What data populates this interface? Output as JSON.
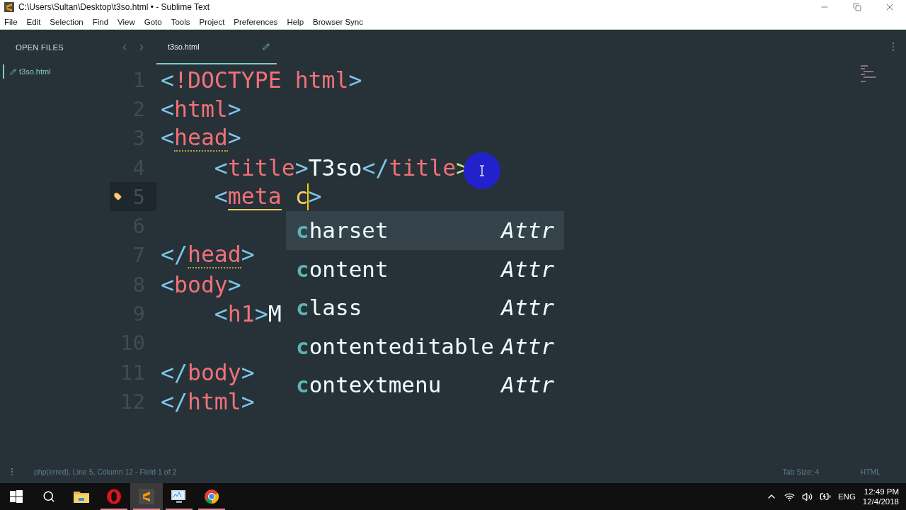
{
  "window": {
    "title": "C:\\Users\\Sultan\\Desktop\\t3so.html • - Sublime Text"
  },
  "menu": [
    "File",
    "Edit",
    "Selection",
    "Find",
    "View",
    "Goto",
    "Tools",
    "Project",
    "Preferences",
    "Help",
    "Browser Sync"
  ],
  "sidebar": {
    "heading": "OPEN FILES",
    "files": [
      {
        "name": "t3so.html",
        "selected": true
      }
    ]
  },
  "tabs": [
    {
      "label": "t3so.html",
      "selected": true
    }
  ],
  "code": {
    "lines": [
      {
        "number": "1",
        "current": false,
        "tokens": [
          {
            "kind": "punct",
            "text": "<"
          },
          {
            "kind": "tag",
            "text": "!DOCTYPE html"
          },
          {
            "kind": "punct",
            "text": ">"
          }
        ]
      },
      {
        "number": "2",
        "current": false,
        "tokens": [
          {
            "kind": "punct",
            "text": "<"
          },
          {
            "kind": "tag",
            "text": "html"
          },
          {
            "kind": "punct",
            "text": ">"
          }
        ]
      },
      {
        "number": "3",
        "current": false,
        "tokens": [
          {
            "kind": "punct",
            "text": "<"
          },
          {
            "kind": "tag",
            "text": "head",
            "underlined": true,
            "dotted": true
          },
          {
            "kind": "punct",
            "text": ">"
          }
        ]
      },
      {
        "number": "4",
        "current": false,
        "tokens": [
          {
            "kind": "punct",
            "text": "    <"
          },
          {
            "kind": "tag",
            "text": "title"
          },
          {
            "kind": "punct",
            "text": ">"
          },
          {
            "kind": "text",
            "text": "T3so"
          },
          {
            "kind": "punct",
            "text": "</"
          },
          {
            "kind": "tag",
            "text": "title"
          },
          {
            "kind": "match",
            "text": ">"
          }
        ]
      },
      {
        "number": "5",
        "current": true,
        "tokens": [
          {
            "kind": "punct",
            "text": "    <"
          },
          {
            "kind": "tag",
            "text": "meta",
            "underlined": true,
            "dotted": false
          },
          {
            "kind": "attr",
            "text": "c",
            "caret": true
          },
          {
            "kind": "punct",
            "text": ">"
          }
        ]
      },
      {
        "number": "6",
        "current": false
      },
      {
        "number": "7",
        "current": false,
        "tokens": [
          {
            "kind": "punct",
            "text": "</"
          },
          {
            "kind": "tag",
            "text": "head",
            "underlined": true,
            "dotted": true
          },
          {
            "kind": "punct",
            "text": ">"
          }
        ]
      },
      {
        "number": "8",
        "current": false,
        "tokens": [
          {
            "kind": "punct",
            "text": "<"
          },
          {
            "kind": "tag",
            "text": "body"
          },
          {
            "kind": "punct",
            "text": ">"
          }
        ]
      },
      {
        "number": "9",
        "current": false,
        "tokens": [
          {
            "kind": "punct",
            "text": "    <"
          },
          {
            "kind": "tag",
            "text": "h1"
          },
          {
            "kind": "punct",
            "text": ">"
          },
          {
            "kind": "text",
            "text": "M"
          }
        ]
      },
      {
        "number": "10",
        "current": false
      },
      {
        "number": "11",
        "current": false,
        "tokens": [
          {
            "kind": "punct",
            "text": "</"
          },
          {
            "kind": "tag",
            "text": "body"
          },
          {
            "kind": "punct",
            "text": ">"
          }
        ]
      },
      {
        "number": "12",
        "current": false,
        "tokens": [
          {
            "kind": "punct",
            "text": "</"
          },
          {
            "kind": "tag",
            "text": "html"
          },
          {
            "kind": "punct",
            "text": ">"
          }
        ]
      }
    ]
  },
  "autocomplete": {
    "items": [
      {
        "match": "c",
        "rest": "harset",
        "type": "Attr",
        "selected": true
      },
      {
        "match": "c",
        "rest": "ontent",
        "type": "Attr",
        "selected": false
      },
      {
        "match": "c",
        "rest": "lass",
        "type": "Attr",
        "selected": false
      },
      {
        "match": "c",
        "rest": "ontenteditable",
        "type": "Attr",
        "selected": false
      },
      {
        "match": "c",
        "rest": "ontextmenu",
        "type": "Attr",
        "selected": false
      }
    ]
  },
  "status_bar": {
    "left": "php(erred), Line 5, Column 12 - Field 1 of 2",
    "tab_size": "Tab Size: 4",
    "syntax": "HTML"
  },
  "taskbar": {
    "apps": [
      {
        "kind": "start",
        "running": false,
        "selected": false
      },
      {
        "kind": "search",
        "running": false,
        "selected": false
      },
      {
        "kind": "folder",
        "running": false,
        "selected": false
      },
      {
        "kind": "opera",
        "running": true,
        "selected": false
      },
      {
        "kind": "sublime",
        "running": true,
        "selected": true
      },
      {
        "kind": "monitor",
        "running": true,
        "selected": false
      },
      {
        "kind": "chrome",
        "running": true,
        "selected": false
      }
    ],
    "language": "ENG",
    "time": "12:49 PM",
    "date": "12/4/2018"
  }
}
